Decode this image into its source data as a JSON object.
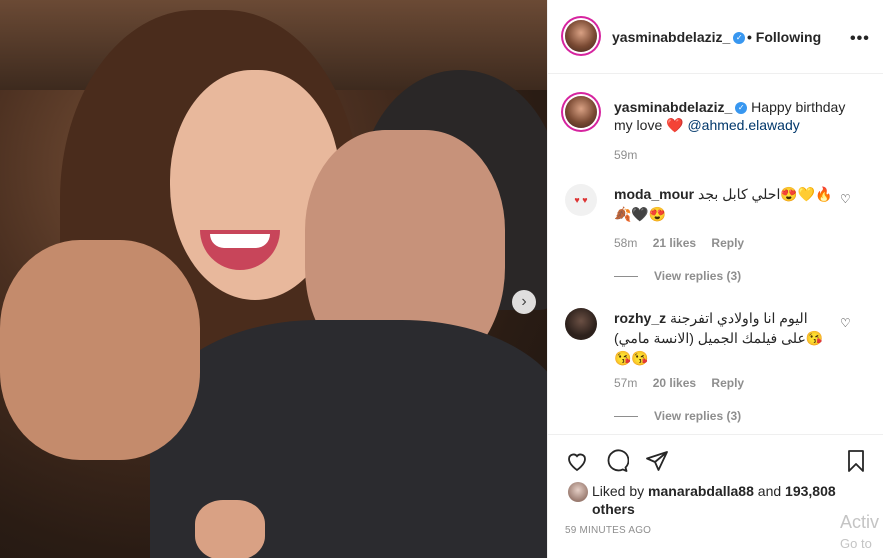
{
  "post": {
    "author": "yasminabdelaziz_",
    "follow_separator": "•",
    "follow_status": "Following",
    "more_label": "•••",
    "next_label": "›",
    "caption": {
      "text": "Happy birthday my love",
      "heart": "❤️",
      "mention": "@ahmed.elawady",
      "time": "59m"
    },
    "comments": [
      {
        "username": "moda_mour",
        "avatar_text": "♥ ♥",
        "text": "احلي كابل بجد😍💛🔥🍂🖤😍",
        "time": "58m",
        "likes": "21 likes",
        "reply_label": "Reply",
        "view_replies": "View replies (3)"
      },
      {
        "username": "rozhy_z",
        "text": "اليوم انا واولادي اتفرجنة على فيلمك الجميل (الانسة مامي)😘😘😘",
        "time": "57m",
        "likes": "20 likes",
        "reply_label": "Reply",
        "view_replies": "View replies (3)"
      }
    ],
    "liked_by_prefix": "Liked by",
    "liked_by_user": "manarabdalla88",
    "liked_by_and": "and",
    "liked_by_others": "193,808 others",
    "timestamp": "59 MINUTES AGO"
  },
  "icons": {
    "verified": "✓",
    "comment_heart": "♡"
  },
  "watermark": {
    "line1": "Activ",
    "line2": "Go to"
  }
}
